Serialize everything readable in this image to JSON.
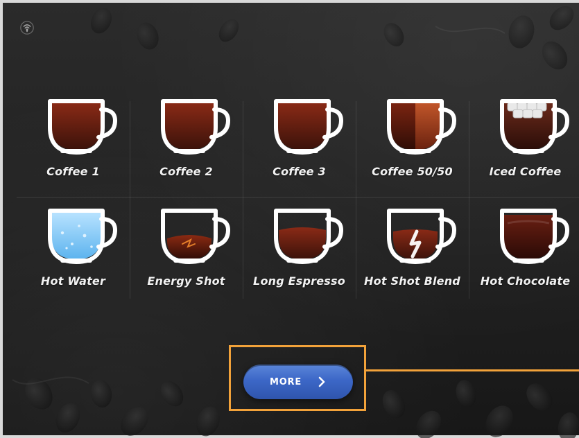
{
  "screen": {
    "status_icon": "wifi-icon"
  },
  "menu": {
    "items": [
      {
        "label": "Coffee 1",
        "cup": "coffee-dark"
      },
      {
        "label": "Coffee 2",
        "cup": "coffee-dark"
      },
      {
        "label": "Coffee 3",
        "cup": "coffee-dark"
      },
      {
        "label": "Coffee 50/50",
        "cup": "coffee-split"
      },
      {
        "label": "Iced Coffee",
        "cup": "iced-coffee"
      },
      {
        "label": "Hot Water",
        "cup": "hot-water"
      },
      {
        "label": "Energy Shot",
        "cup": "energy-shot"
      },
      {
        "label": "Long Espresso",
        "cup": "long-espresso"
      },
      {
        "label": "Hot Shot Blend",
        "cup": "hot-shot-blend"
      },
      {
        "label": "Hot Chocolate",
        "cup": "hot-chocolate"
      }
    ]
  },
  "more": {
    "label": "MORE",
    "icon": "chevron-right-icon",
    "button_color": "#3c67c7",
    "highlight_color": "#f2a23a"
  }
}
